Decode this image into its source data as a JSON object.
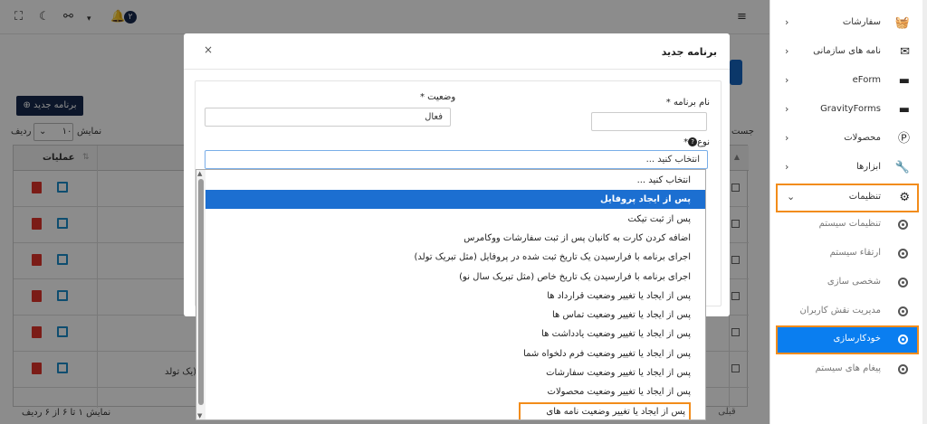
{
  "topbar": {
    "notification_count": "۲",
    "icons": [
      "expand-icon",
      "moon-icon",
      "link-icon",
      "chevron-down-icon",
      "bell-icon",
      "menu-icon"
    ]
  },
  "list_page": {
    "new_program_button": "برنامه جدید",
    "show_label": "نمایش",
    "rows_label": "ردیف",
    "rows_value": "۱۰",
    "search_label": "جست",
    "operations_header": "عملیات",
    "cut_cell_text": "یک تولد)",
    "footer_info": "نمایش ۱ تا ۶ از ۶ ردیف",
    "prev_label": "قبلی"
  },
  "modal": {
    "title": "برنامه جدید",
    "close": "×",
    "name_label": "نام برنامه *",
    "name_value": "",
    "status_label": "وضعیت *",
    "status_value": "فعال",
    "type_label": "نوع",
    "type_required": "*",
    "type_placeholder": "انتخاب کنید ..."
  },
  "dropdown": {
    "options": [
      "انتخاب کنید ...",
      "پس از ایجاد پروفایل",
      "پس از ثبت تیکت",
      "اضافه کردن کارت به کانبان پس از ثبت سفارشات ووکامرس",
      "اجرای برنامه با فرارسیدن یک تاریخ ثبت شده در پروفایل (مثل تبریک تولد)",
      "اجرای برنامه با فرارسیدن یک تاریخ خاص (مثل تبریک سال نو)",
      "پس از ایجاد یا تغییر وضعیت قرارداد ها",
      "پس از ایجاد یا تغییر وضعیت تماس ها",
      "پس از ایجاد یا تغییر وضعیت یادداشت ها",
      "پس از ایجاد یا تغییر وضعیت فرم دلخواه شما",
      "پس از ایجاد یا تغییر وضعیت سفارشات",
      "پس از ایجاد یا تغییر وضعیت محصولات",
      "پس از ایجاد یا تغییر وضعیت نامه های سازمانی"
    ],
    "selected_index": 1,
    "highlighted_index": 12
  },
  "sidebar": {
    "items": [
      {
        "label": "سفارشات",
        "icon": "basket-icon"
      },
      {
        "label": "نامه های سازمانی",
        "icon": "envelope-icon"
      },
      {
        "label": "eForm",
        "icon": "folder-icon"
      },
      {
        "label": "GravityForms",
        "icon": "folder-icon"
      },
      {
        "label": "محصولات",
        "icon": "product-icon"
      },
      {
        "label": "ابزارها",
        "icon": "wrench-icon"
      },
      {
        "label": "تنظیمات",
        "icon": "gear-icon"
      }
    ],
    "sub_items": [
      "تنظیمات سیستم",
      "ارتقاء سیستم",
      "شخصی سازی",
      "مدیریت نقش کاربران",
      "خودکارسازی",
      "پیغام های سیستم"
    ]
  },
  "colors": {
    "accent": "#0a7ef0",
    "dropdown_selected": "#1c6fd1",
    "highlight_outline": "#f28c1a",
    "primary_dark": "#17294d",
    "danger": "#e0342b"
  }
}
